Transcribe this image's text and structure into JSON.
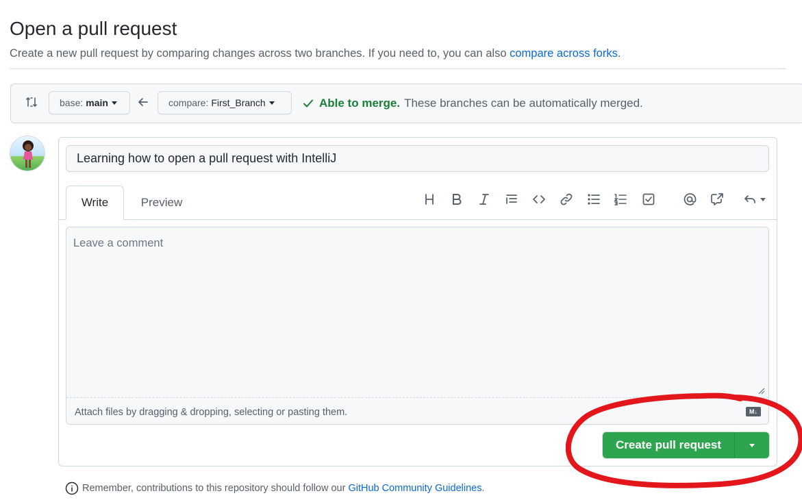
{
  "header": {
    "title": "Open a pull request",
    "subtitle": "Create a new pull request by comparing changes across two branches. If you need to, you can also",
    "subtitle_link": "compare across forks",
    "subtitle_end": "."
  },
  "range": {
    "base_label": "base:",
    "base_branch": "main",
    "compare_label": "compare:",
    "compare_branch": "First_Branch",
    "merge_status": "Able to merge.",
    "merge_detail": "These branches can be automatically merged."
  },
  "form": {
    "title_value": "Learning how to open a pull request with IntelliJ",
    "tabs": [
      {
        "label": "Write",
        "active": true
      },
      {
        "label": "Preview",
        "active": false
      }
    ],
    "toolbar": [
      "heading-icon",
      "bold-icon",
      "italic-icon",
      "quote-icon",
      "code-icon",
      "link-icon",
      "unordered-list-icon",
      "ordered-list-icon",
      "task-list-icon",
      "mention-icon",
      "cross-reference-icon",
      "reply-icon"
    ],
    "comment_placeholder": "Leave a comment",
    "attach_text": "Attach files by dragging & dropping, selecting or pasting them.",
    "markdown_badge": "M↓",
    "submit_label": "Create pull request"
  },
  "footer": {
    "note": "Remember, contributions to this repository should follow our",
    "link": "GitHub Community Guidelines",
    "end": "."
  },
  "colors": {
    "accent_link": "#0969da",
    "success": "#1a7f37",
    "button_green": "#2da44e",
    "annotation_red": "#e3171b"
  }
}
